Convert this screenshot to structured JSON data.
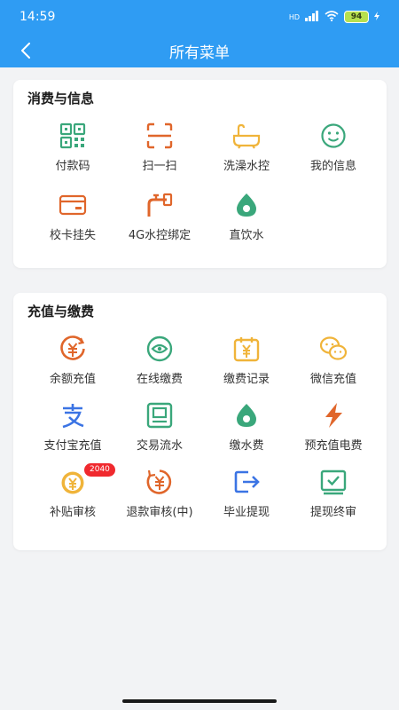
{
  "status": {
    "time": "14:59",
    "network": "HD",
    "battery": "94"
  },
  "nav": {
    "title": "所有菜单"
  },
  "sections": [
    {
      "title": "消费与信息",
      "items": [
        {
          "label": "付款码"
        },
        {
          "label": "扫一扫"
        },
        {
          "label": "洗澡水控"
        },
        {
          "label": "我的信息"
        },
        {
          "label": "校卡挂失"
        },
        {
          "label": "4G水控绑定"
        },
        {
          "label": "直饮水"
        }
      ]
    },
    {
      "title": "充值与缴费",
      "items": [
        {
          "label": "余额充值"
        },
        {
          "label": "在线缴费"
        },
        {
          "label": "缴费记录"
        },
        {
          "label": "微信充值"
        },
        {
          "label": "支付宝充值"
        },
        {
          "label": "交易流水"
        },
        {
          "label": "缴水费"
        },
        {
          "label": "预充值电费"
        },
        {
          "label": "补贴审核",
          "badge": "2040"
        },
        {
          "label": "退款审核(中)"
        },
        {
          "label": "毕业提现"
        },
        {
          "label": "提现终审"
        }
      ]
    }
  ],
  "colors": {
    "header": "#2f9cf3",
    "green": "#3aa77b",
    "orange": "#e0662b",
    "yellow": "#f0b43a",
    "blue": "#3b74e4",
    "badge": "#f0292e"
  }
}
